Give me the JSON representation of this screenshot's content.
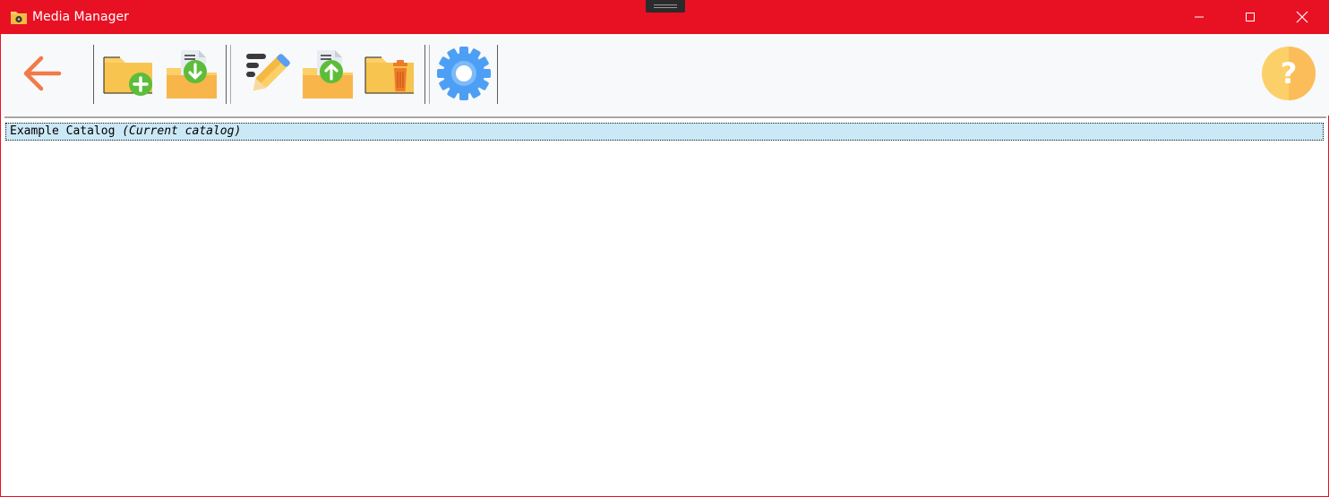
{
  "window": {
    "title": "Media Manager",
    "accent_color": "#e81123",
    "app_icon": "folder-media-icon"
  },
  "title_buttons": [
    {
      "name": "minimize",
      "icon": "minimize-icon"
    },
    {
      "name": "maximize",
      "icon": "maximize-icon"
    },
    {
      "name": "close",
      "icon": "close-icon"
    }
  ],
  "toolbar": {
    "buttons": [
      {
        "name": "back",
        "icon": "arrow-left-icon",
        "color": "#f07a4a"
      },
      {
        "name": "new-catalog",
        "icon": "folder-add-icon"
      },
      {
        "name": "import-catalog",
        "icon": "folder-import-icon"
      },
      {
        "name": "rename-catalog",
        "icon": "edit-pencil-icon"
      },
      {
        "name": "export-catalog",
        "icon": "folder-export-icon"
      },
      {
        "name": "delete-catalog",
        "icon": "folder-delete-icon"
      },
      {
        "name": "settings",
        "icon": "gear-icon",
        "color": "#4d9ff5"
      },
      {
        "name": "help",
        "icon": "help-icon",
        "color": "#fcd069"
      }
    ],
    "help_symbol": "?"
  },
  "catalog_list": {
    "items": [
      {
        "name": "Example Catalog",
        "note": "(Current catalog)",
        "selected": true
      }
    ],
    "selection_color": "#cbe8f6"
  }
}
